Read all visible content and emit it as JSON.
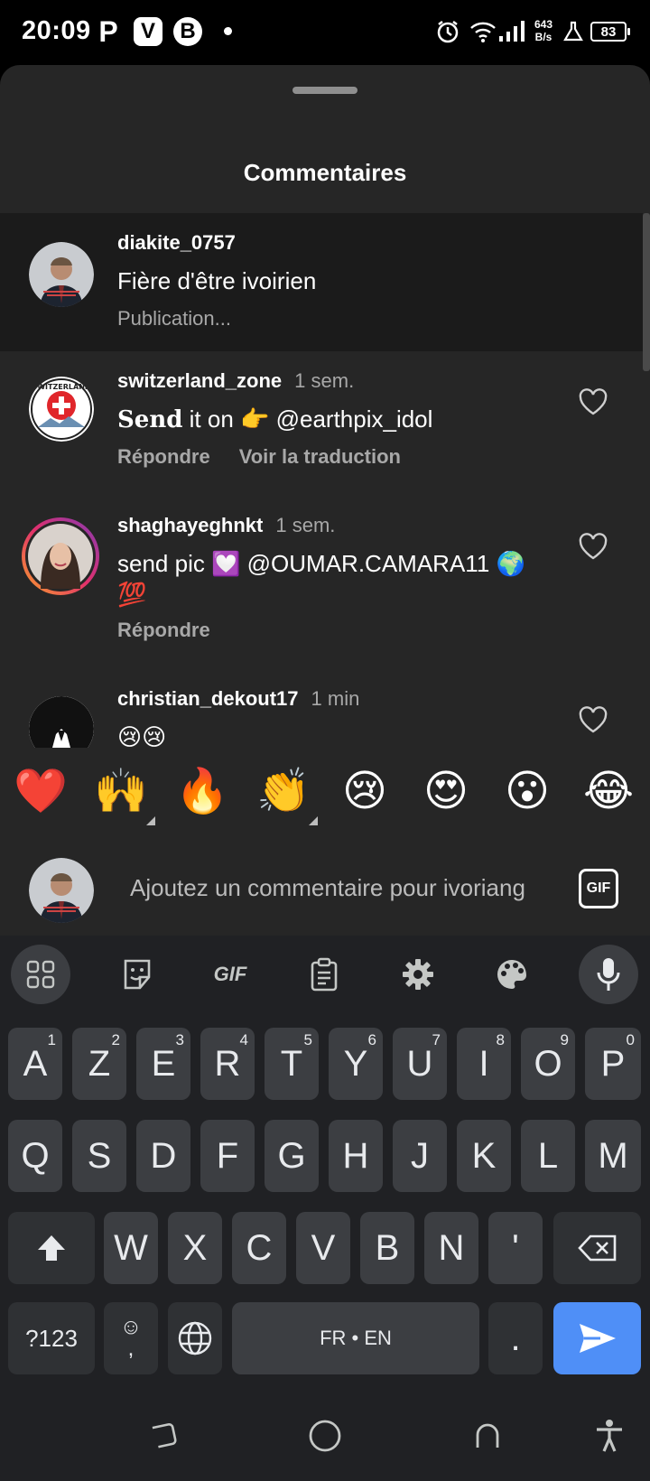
{
  "status_bar": {
    "time": "20:09",
    "app_icons": [
      "P",
      "V",
      "B"
    ],
    "net_speed_value": "643",
    "net_speed_unit": "B/s",
    "battery": "83"
  },
  "sheet": {
    "title": "Commentaires"
  },
  "comments": [
    {
      "username": "diakite_0757",
      "time": "",
      "text": "Fière d'être ivoirien",
      "status": "Publication...",
      "actions": []
    },
    {
      "username": "switzerland_zone",
      "time": "1 sem.",
      "text_bold": "Send",
      "text_rest": " it on 👉 @earthpix_idol",
      "actions": [
        "Répondre",
        "Voir la traduction"
      ]
    },
    {
      "username": "shaghayeghnkt",
      "time": "1 sem.",
      "text": "send pic 💟 @OUMAR.CAMARA11 🌍 💯",
      "actions": [
        "Répondre"
      ]
    },
    {
      "username": "christian_dekout17",
      "time": "1 min",
      "text": "😢😢",
      "actions": []
    }
  ],
  "emoji_bar": [
    "❤️",
    "🙌",
    "🔥",
    "👏",
    "😢",
    "😍",
    "😮",
    "😂"
  ],
  "comment_input": {
    "placeholder": "Ajoutez un commentaire pour ivoriang",
    "gif_label": "GIF"
  },
  "keyboard": {
    "toolbar": {
      "gif_label": "GIF"
    },
    "row1": [
      {
        "k": "A",
        "h": "1"
      },
      {
        "k": "Z",
        "h": "2"
      },
      {
        "k": "E",
        "h": "3"
      },
      {
        "k": "R",
        "h": "4"
      },
      {
        "k": "T",
        "h": "5"
      },
      {
        "k": "Y",
        "h": "6"
      },
      {
        "k": "U",
        "h": "7"
      },
      {
        "k": "I",
        "h": "8"
      },
      {
        "k": "O",
        "h": "9"
      },
      {
        "k": "P",
        "h": "0"
      }
    ],
    "row2": [
      "Q",
      "S",
      "D",
      "F",
      "G",
      "H",
      "J",
      "K",
      "L",
      "M"
    ],
    "row3": [
      "W",
      "X",
      "C",
      "V",
      "B",
      "N",
      "'"
    ],
    "symbols_label": "?123",
    "emoji_key_top": "☺",
    "emoji_key_bottom": ",",
    "space_label": "FR • EN",
    "period_label": "."
  },
  "colors": {
    "sheet_bg": "#262626",
    "highlight_bg": "#1b1b1b",
    "keyboard_bg": "#202124",
    "key_bg": "#3c3e42",
    "send_key": "#4f8ff7"
  }
}
